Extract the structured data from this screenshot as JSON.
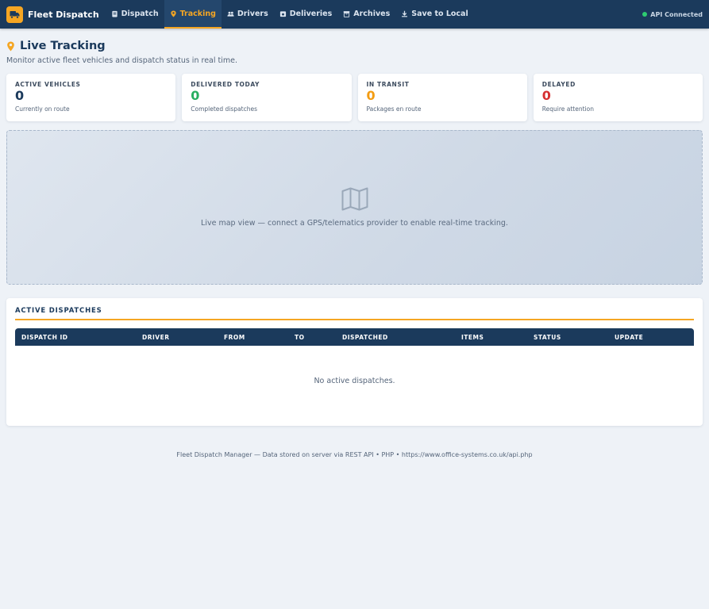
{
  "app": {
    "name": "Fleet Dispatch",
    "brand_color": "#f5a623",
    "nav_color": "#1b3a5c"
  },
  "nav": [
    {
      "label": "Dispatch",
      "icon": "clipboard-icon",
      "active": false
    },
    {
      "label": "Tracking",
      "icon": "location-pin-icon",
      "active": true
    },
    {
      "label": "Drivers",
      "icon": "users-icon",
      "active": false
    },
    {
      "label": "Deliveries",
      "icon": "box-icon",
      "active": false
    },
    {
      "label": "Archives",
      "icon": "archive-icon",
      "active": false
    },
    {
      "label": "Save to Local",
      "icon": "download-icon",
      "active": false
    }
  ],
  "api_status": {
    "label": "API Connected",
    "color": "#2ecc71"
  },
  "page": {
    "title": "Live Tracking",
    "subtitle": "Monitor active fleet vehicles and dispatch status in real time."
  },
  "stats": [
    {
      "label": "ACTIVE VEHICLES",
      "value": "0",
      "sub": "Currently on route",
      "color": "#1b3a5c"
    },
    {
      "label": "DELIVERED TODAY",
      "value": "0",
      "sub": "Completed dispatches",
      "color": "#27ae60"
    },
    {
      "label": "IN TRANSIT",
      "value": "0",
      "sub": "Packages en route",
      "color": "#f39c12"
    },
    {
      "label": "DELAYED",
      "value": "0",
      "sub": "Require attention",
      "color": "#d63031"
    }
  ],
  "map": {
    "message": "Live map view — connect a GPS/telematics provider to enable real-time tracking."
  },
  "dispatches": {
    "title": "ACTIVE DISPATCHES",
    "columns": [
      "DISPATCH ID",
      "DRIVER",
      "FROM",
      "TO",
      "DISPATCHED",
      "ITEMS",
      "STATUS",
      "UPDATE"
    ],
    "empty_message": "No active dispatches."
  },
  "footer": "Fleet Dispatch Manager — Data stored on server via REST API • PHP • https://www.office-systems.co.uk/api.php"
}
